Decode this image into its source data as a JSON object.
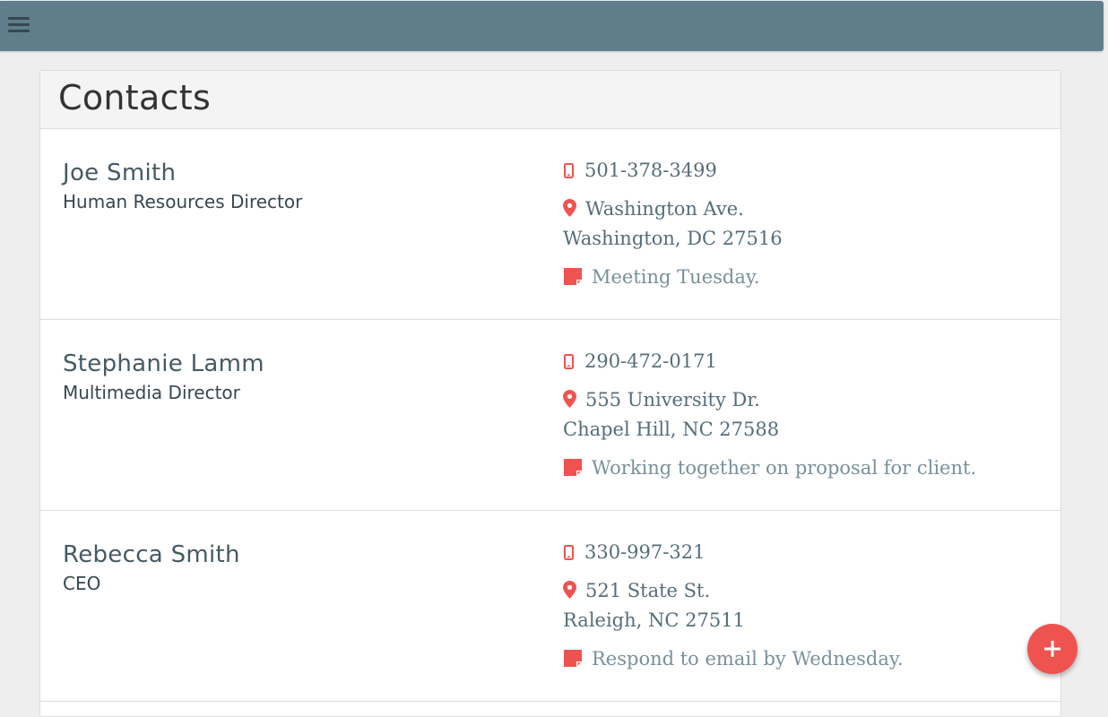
{
  "header": {
    "menu_icon": "hamburger-menu-icon",
    "bar_color": "#607d8b"
  },
  "page": {
    "title": "Contacts"
  },
  "colors": {
    "accent": "#ef5350",
    "name_text": "#455a64"
  },
  "icons": {
    "phone": "mobile-phone-icon",
    "address": "map-pin-icon",
    "note": "note-icon",
    "fab": "plus-icon"
  },
  "contacts": [
    {
      "name": "Joe Smith",
      "role": "Human Resources Director",
      "phone": "501-378-3499",
      "address_line1": "Washington Ave.",
      "address_line2": "Washington, DC 27516",
      "note": "Meeting Tuesday."
    },
    {
      "name": "Stephanie Lamm",
      "role": "Multimedia Director",
      "phone": "290-472-0171",
      "address_line1": "555 University Dr.",
      "address_line2": "Chapel Hill, NC 27588",
      "note": "Working together on proposal for client."
    },
    {
      "name": "Rebecca Smith",
      "role": "CEO",
      "phone": "330-997-321",
      "address_line1": "521 State St.",
      "address_line2": "Raleigh, NC 27511",
      "note": "Respond to email by Wednesday."
    }
  ]
}
